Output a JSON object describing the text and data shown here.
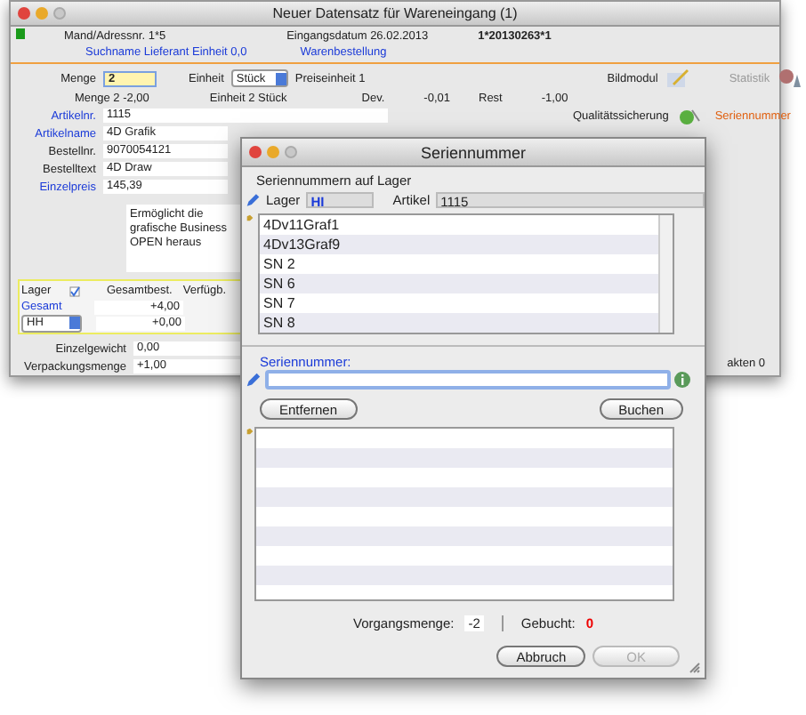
{
  "main_window": {
    "title": "Neuer Datensatz für Wareneingang (1)",
    "header": {
      "number_label": "Mand/Adressnr. 1*5",
      "date": "Eingangsdatum 26.02.2013",
      "doc_number": "1*20130263*1",
      "link_1": "Suchname Lieferant Einheit 0,0",
      "link_2": "Warenbestellung"
    },
    "quantity": {
      "label": "Menge",
      "value": "2",
      "unit_label": "Einheit",
      "unit": "Stück",
      "price_unit": "Preiseinheit 1"
    },
    "secondary": [
      "Menge 2 -2,00",
      "Einheit 2 Stück",
      "Dev.",
      "-0,01",
      "Rest",
      "-1,00"
    ],
    "tools": {
      "image_module": "Bildmodul",
      "statistics": "Statistik",
      "quality": "Qualitätssicherung",
      "serial": "Seriennummer"
    },
    "fields": [
      {
        "label": "Artikelnr.",
        "value": "1115",
        "link": true
      },
      {
        "label": "Artikelname",
        "value": "4D Grafik",
        "link": true
      },
      {
        "label": "Bestellnr.",
        "value": "9070054121",
        "link": false
      },
      {
        "label": "Bestelltext",
        "value": "4D Draw",
        "link": false
      },
      {
        "label": "Einzelpreis",
        "value": "145,39",
        "link": true
      }
    ],
    "description": "Ermöglicht die grafische Business OPEN heraus",
    "stock": {
      "columns": [
        "Lager",
        "Gesamtbest.",
        "Verfügb."
      ],
      "checked": true,
      "total_label": "Gesamt",
      "total_value": "+4,00",
      "warehouse": "HH",
      "warehouse_value": "+0,00"
    },
    "bottom_fields": [
      {
        "label": "Einzelgewicht",
        "value": "0,00"
      },
      {
        "label": "Verpackungsmenge",
        "value": "+1,00"
      }
    ],
    "side_text": "akten 0"
  },
  "dialog": {
    "title": "Seriennummer",
    "section": "Seriennummern auf Lager",
    "warehouse_label": "Lager",
    "warehouse": "HI",
    "article_label": "Artikel",
    "article": "1115",
    "serials": [
      "4Dv11Graf1",
      "4Dv13Graf9",
      "SN 2",
      "SN 6",
      "SN 7",
      "SN 8"
    ],
    "input_label": "Seriennummer:",
    "remove_button": "Entfernen",
    "book_button": "Buchen",
    "quantity_label": "Vorgangsmenge:",
    "quantity": "-2",
    "booked_label": "Gebucht:",
    "booked": "0",
    "cancel_button": "Abbruch",
    "ok_button": {
      "label": "OK",
      "disabled": true
    }
  }
}
